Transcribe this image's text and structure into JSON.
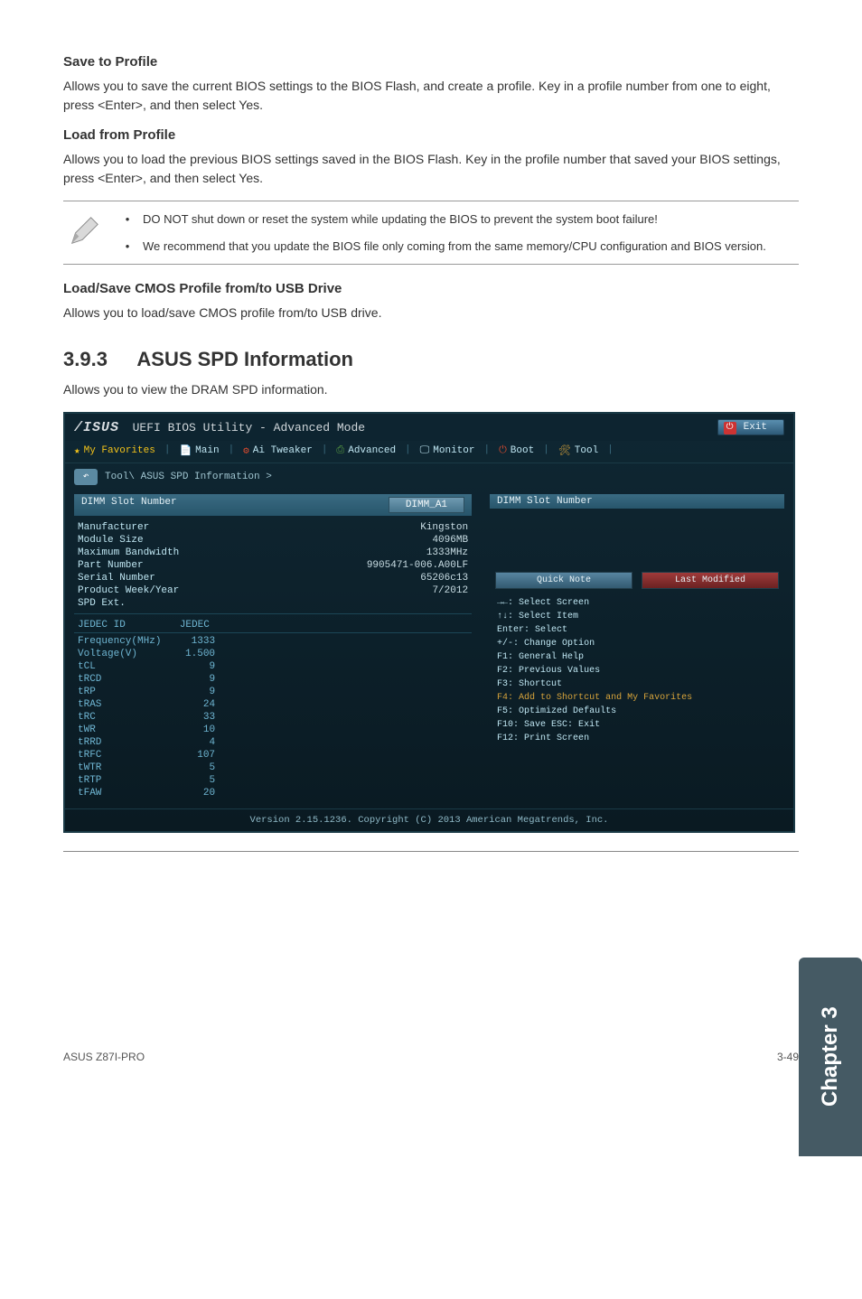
{
  "sections": {
    "save_profile": {
      "title": "Save to Profile",
      "body": "Allows you to save the current BIOS settings to the BIOS Flash, and create a profile. Key in a profile number from one to eight, press <Enter>, and then select Yes."
    },
    "load_profile": {
      "title": "Load from Profile",
      "body": "Allows you to load the previous BIOS settings saved in the BIOS Flash. Key in the profile number that saved your BIOS settings, press <Enter>, and then select Yes."
    },
    "notes": {
      "n1": "DO NOT shut down or reset the system while updating the BIOS to prevent the system boot failure!",
      "n2": "We recommend that you update the BIOS file only coming from the same memory/CPU configuration and BIOS version."
    },
    "load_save_cmos": {
      "title": "Load/Save CMOS Profile from/to USB Drive",
      "body": "Allows you to load/save CMOS profile from/to USB drive."
    },
    "spd": {
      "num": "3.9.3",
      "title": "ASUS SPD Information",
      "body": "Allows you to view the DRAM SPD information."
    }
  },
  "bios": {
    "logo": "/ISUS",
    "title": "UEFI BIOS Utility - Advanced Mode",
    "exit": "Exit",
    "menu": {
      "fav": "My Favorites",
      "main": "Main",
      "tweaker": "Ai Tweaker",
      "advanced": "Advanced",
      "monitor": "Monitor",
      "boot": "Boot",
      "tool": "Tool"
    },
    "crumb": "Tool\\ ASUS SPD Information >",
    "left": {
      "header": "DIMM Slot Number",
      "dropdown": "DIMM_A1",
      "rows": [
        {
          "k": "Manufacturer",
          "v": "Kingston"
        },
        {
          "k": "Module Size",
          "v": "4096MB"
        },
        {
          "k": "Maximum Bandwidth",
          "v": "1333MHz"
        },
        {
          "k": "Part Number",
          "v": "9905471-006.A00LF"
        },
        {
          "k": "Serial Number",
          "v": "65206c13"
        },
        {
          "k": "Product Week/Year",
          "v": "7/2012"
        },
        {
          "k": "SPD Ext.",
          "v": ""
        }
      ],
      "jedec_label": "JEDEC ID",
      "jedec_val": "JEDEC",
      "timing": [
        {
          "k": "Frequency(MHz)",
          "v": "1333"
        },
        {
          "k": "Voltage(V)",
          "v": "1.500"
        },
        {
          "k": "tCL",
          "v": "9"
        },
        {
          "k": "tRCD",
          "v": "9"
        },
        {
          "k": "tRP",
          "v": "9"
        },
        {
          "k": "tRAS",
          "v": "24"
        },
        {
          "k": "tRC",
          "v": "33"
        },
        {
          "k": "tWR",
          "v": "10"
        },
        {
          "k": "tRRD",
          "v": "4"
        },
        {
          "k": "tRFC",
          "v": "107"
        },
        {
          "k": "tWTR",
          "v": "5"
        },
        {
          "k": "tRTP",
          "v": "5"
        },
        {
          "k": "tFAW",
          "v": "20"
        }
      ]
    },
    "right": {
      "header": "DIMM Slot Number",
      "desc": "",
      "quick": "Quick Note",
      "lastmod": "Last Modified",
      "help": [
        "→←: Select Screen",
        "↑↓: Select Item",
        "Enter: Select",
        "+/-: Change Option",
        "F1: General Help",
        "F2: Previous Values",
        "F3: Shortcut",
        "F4: Add to Shortcut and My Favorites",
        "F5: Optimized Defaults",
        "F10: Save  ESC: Exit",
        "F12: Print Screen"
      ]
    },
    "footer": "Version 2.15.1236. Copyright (C) 2013 American Megatrends, Inc."
  },
  "chapter": "Chapter 3",
  "footer_left": "ASUS Z87I-PRO",
  "footer_right": "3-49"
}
